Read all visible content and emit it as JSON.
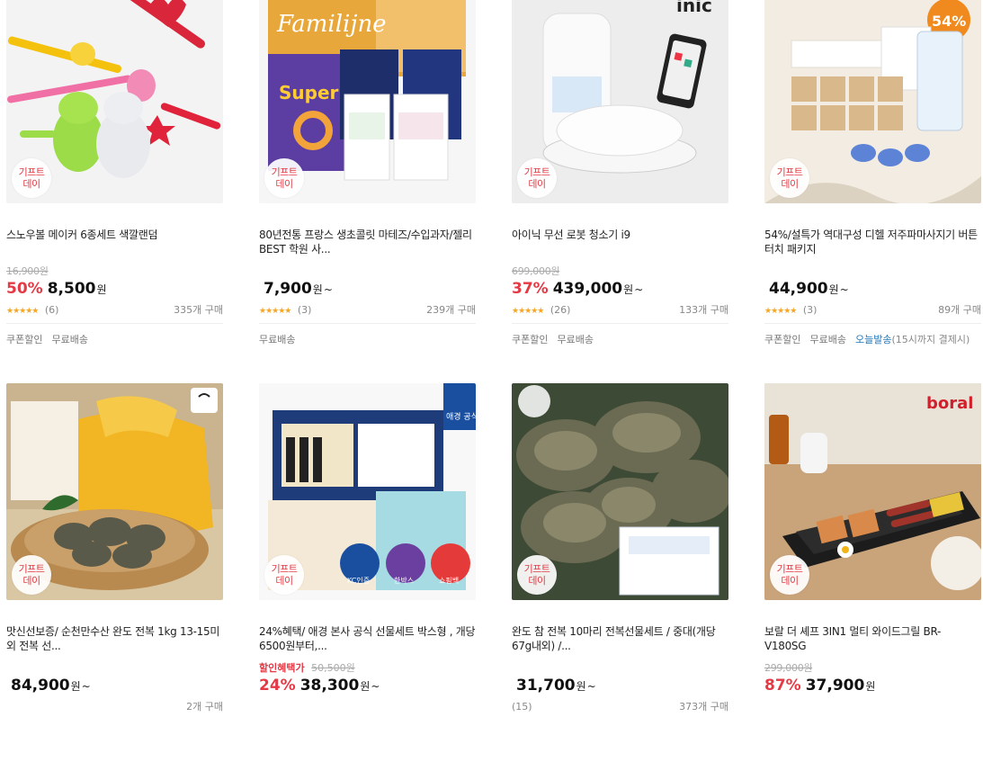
{
  "badge": {
    "line1": "기프트",
    "line2": "데이"
  },
  "products": [
    {
      "title": "스노우볼 메이커 6종세트 색깔랜덤",
      "original_price": "16,900원",
      "discount": "50%",
      "price": "8,500",
      "currency": "원",
      "suffix": "",
      "rating_stars": "★★★★★",
      "reviews": "(6)",
      "purchases": "335개 구매",
      "tags": [
        "쿠폰할인",
        "무료배송"
      ]
    },
    {
      "title": "80년전통 프랑스 생초콜릿 마테즈/수입과자/젤리 BEST 학원 사...",
      "original_price": "",
      "discount": "",
      "price": "7,900",
      "currency": "원",
      "suffix": "~",
      "rating_stars": "★★★★★",
      "reviews": "(3)",
      "purchases": "239개 구매",
      "tags": [
        "무료배송"
      ]
    },
    {
      "title": "아이닉 무선 로봇 청소기 i9",
      "original_price": "699,000원",
      "discount": "37%",
      "price": "439,000",
      "currency": "원",
      "suffix": "~",
      "rating_stars": "★★★★★",
      "reviews": "(26)",
      "purchases": "133개 구매",
      "tags": [
        "쿠폰할인",
        "무료배송"
      ],
      "brand_logo": "inic"
    },
    {
      "title": "54%/설특가 역대구성 디헬 저주파마사지기 버튼 터치 패키지",
      "original_price": "",
      "discount": "",
      "price": "44,900",
      "currency": "원",
      "suffix": "~",
      "rating_stars": "★★★★★",
      "reviews": "(3)",
      "purchases": "89개 구매",
      "tags": [
        "쿠폰할인",
        "무료배송"
      ],
      "today_ship": "오늘발송",
      "today_note": "(15시까지 결제시)",
      "image_badge": "54%"
    },
    {
      "title": "맛신선보증/ 순천만수산 완도 전복 1kg 13-15미 외 전복 선...",
      "original_price": "",
      "discount": "",
      "price": "84,900",
      "currency": "원",
      "suffix": "~",
      "purchases": "2개 구매"
    },
    {
      "title": "24%혜택/ 애경 본사 공식 선물세트 박스형 , 개당6500원부터,...",
      "promo_label": "할인혜택가",
      "original_price": "50,500원",
      "discount": "24%",
      "price": "38,300",
      "currency": "원",
      "suffix": "~",
      "image_badge": "애경 공식",
      "image_chips": [
        "KC인증",
        "한박스",
        "쇼핑백"
      ]
    },
    {
      "title": "완도 참 전복 10마리 전복선물세트 / 중대(개당67g내외) /...",
      "original_price": "",
      "discount": "",
      "price": "31,700",
      "currency": "원",
      "suffix": "~",
      "reviews": "(15)",
      "purchases": "373개 구매"
    },
    {
      "title": "보랄 더 셰프 3IN1 멀티 와이드그릴 BR-V180SG",
      "original_price": "299,000원",
      "discount": "87%",
      "price": "37,900",
      "currency": "원",
      "suffix": "",
      "brand_logo": "boral"
    }
  ],
  "colors": {
    "accent_red": "#e33a45",
    "star": "#f5a623",
    "link_blue": "#1f76b8"
  }
}
